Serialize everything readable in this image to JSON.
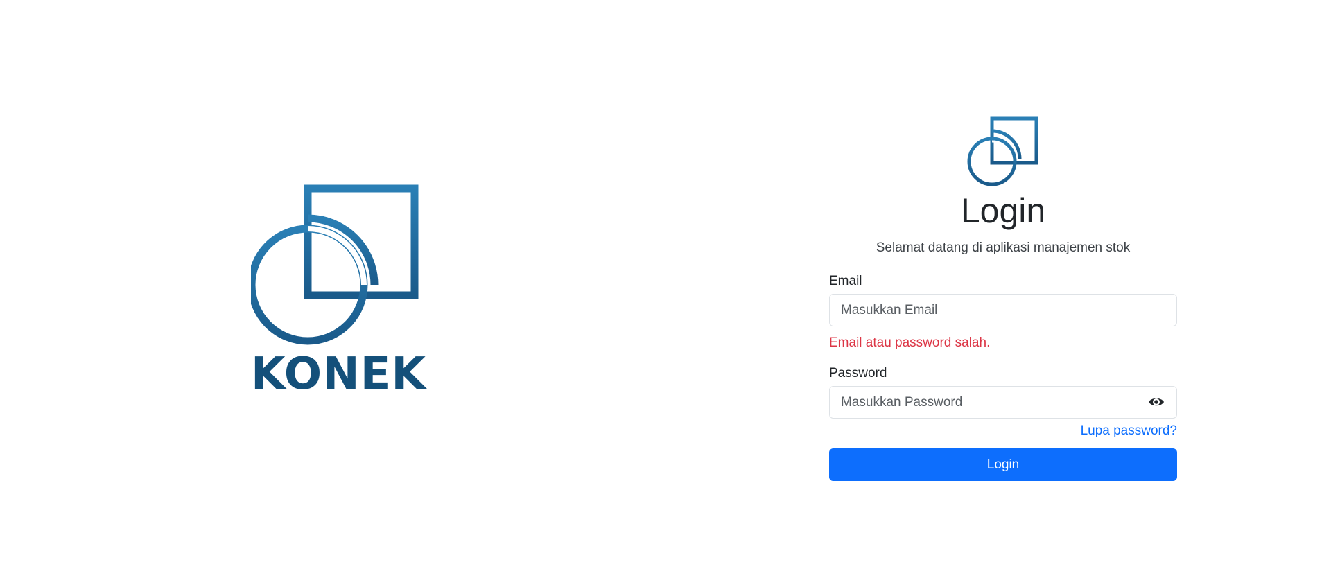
{
  "brand": {
    "name": "KONEK",
    "logo_icon": "konek-logo-icon",
    "color_primary": "#2778ad",
    "color_dark": "#14507a"
  },
  "login": {
    "logo_icon": "konek-logo-icon",
    "title": "Login",
    "subtitle": "Selamat datang di aplikasi manajemen stok",
    "email": {
      "label": "Email",
      "placeholder": "Masukkan Email",
      "value": "",
      "error": "Email atau password salah."
    },
    "password": {
      "label": "Password",
      "placeholder": "Masukkan Password",
      "value": "",
      "toggle_icon": "eye-icon"
    },
    "forgot_password": "Lupa password?",
    "submit_label": "Login"
  },
  "colors": {
    "primary_button": "#0d6efd",
    "link": "#0d6efd",
    "error": "#dc3545",
    "input_border": "#dee2e6"
  }
}
